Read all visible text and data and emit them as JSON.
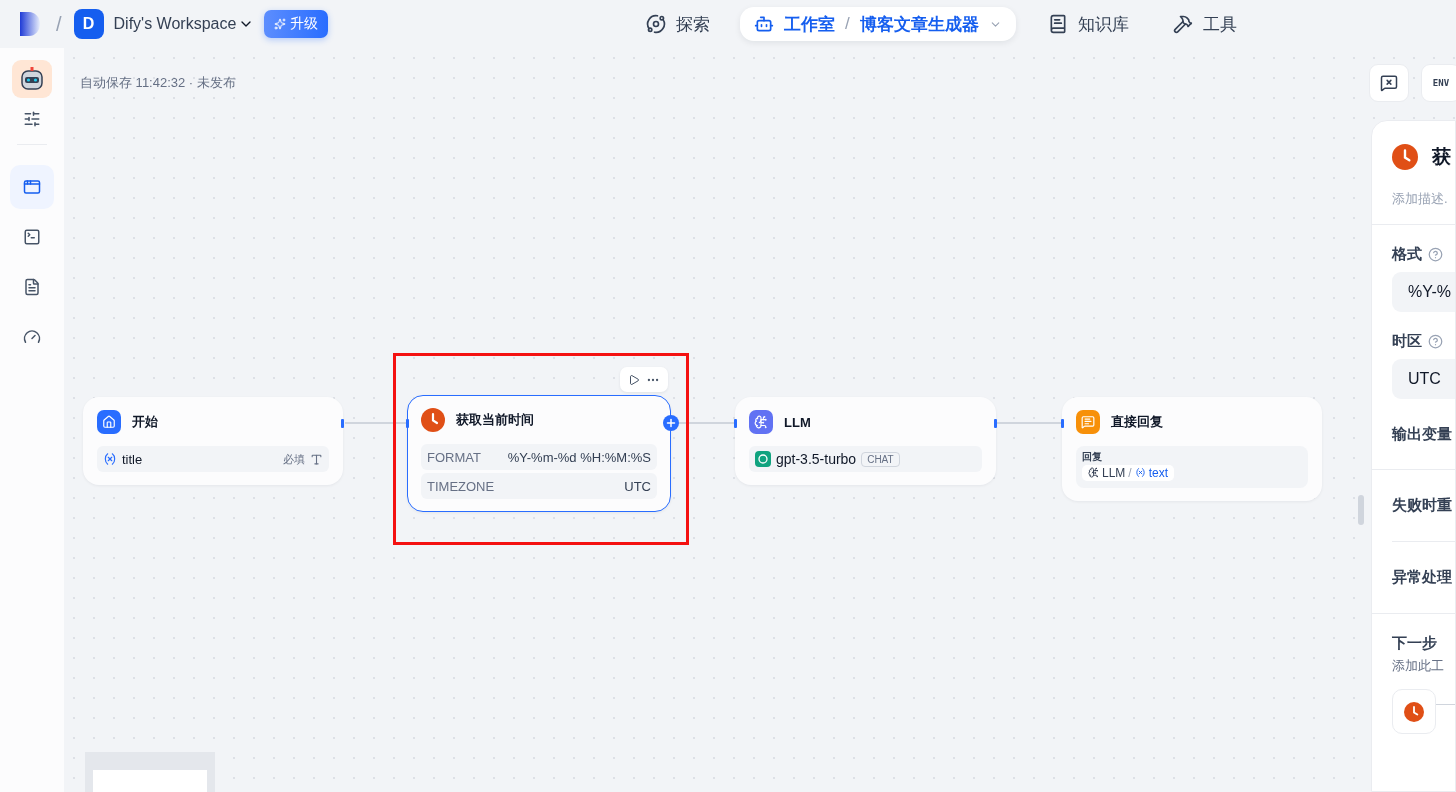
{
  "nav": {
    "separator": "/",
    "workspace": {
      "initial": "D",
      "name": "Dify's Workspace"
    },
    "upgrade": "升级",
    "items": [
      {
        "kind": "explore",
        "label": "探索",
        "selected": false
      },
      {
        "kind": "studio",
        "label": "工作室",
        "separator": "/",
        "app": "博客文章生成器",
        "selected": true
      },
      {
        "kind": "datasets",
        "label": "知识库",
        "selected": false
      },
      {
        "kind": "tools",
        "label": "工具",
        "selected": false
      }
    ]
  },
  "sidebar": {
    "items": [
      {
        "kind": "orchestrate",
        "selected": true
      },
      {
        "kind": "logs",
        "selected": false
      },
      {
        "kind": "annotations",
        "selected": false
      },
      {
        "kind": "monitoring",
        "selected": false
      }
    ]
  },
  "canvas": {
    "status": "自动保存 11:42:32 · 未发布",
    "env_button": "ENV",
    "nodes": [
      {
        "kind": "start",
        "title": "开始",
        "variables": [
          {
            "name": "title",
            "required": "必填"
          }
        ]
      },
      {
        "kind": "tool",
        "title": "获取当前时间",
        "highlighted": true,
        "params": [
          {
            "key": "FORMAT",
            "value": "%Y-%m-%d %H:%M:%S"
          },
          {
            "key": "TIMEZONE",
            "value": "UTC"
          }
        ]
      },
      {
        "kind": "llm",
        "title": "LLM",
        "model": "gpt-3.5-turbo",
        "mode": "CHAT"
      },
      {
        "kind": "answer",
        "title": "直接回复",
        "label": "回复",
        "source": "LLM",
        "separator": "/",
        "variable": "text"
      }
    ]
  },
  "panel": {
    "title": "获",
    "description": "添加描述.",
    "fields": [
      {
        "label": "格式",
        "value": "%Y-%"
      },
      {
        "label": "时区",
        "value": "UTC"
      }
    ],
    "sections": [
      "输出变量",
      "失败时重",
      "异常处理"
    ],
    "next": {
      "title": "下一步",
      "hint": "添加此工"
    }
  }
}
